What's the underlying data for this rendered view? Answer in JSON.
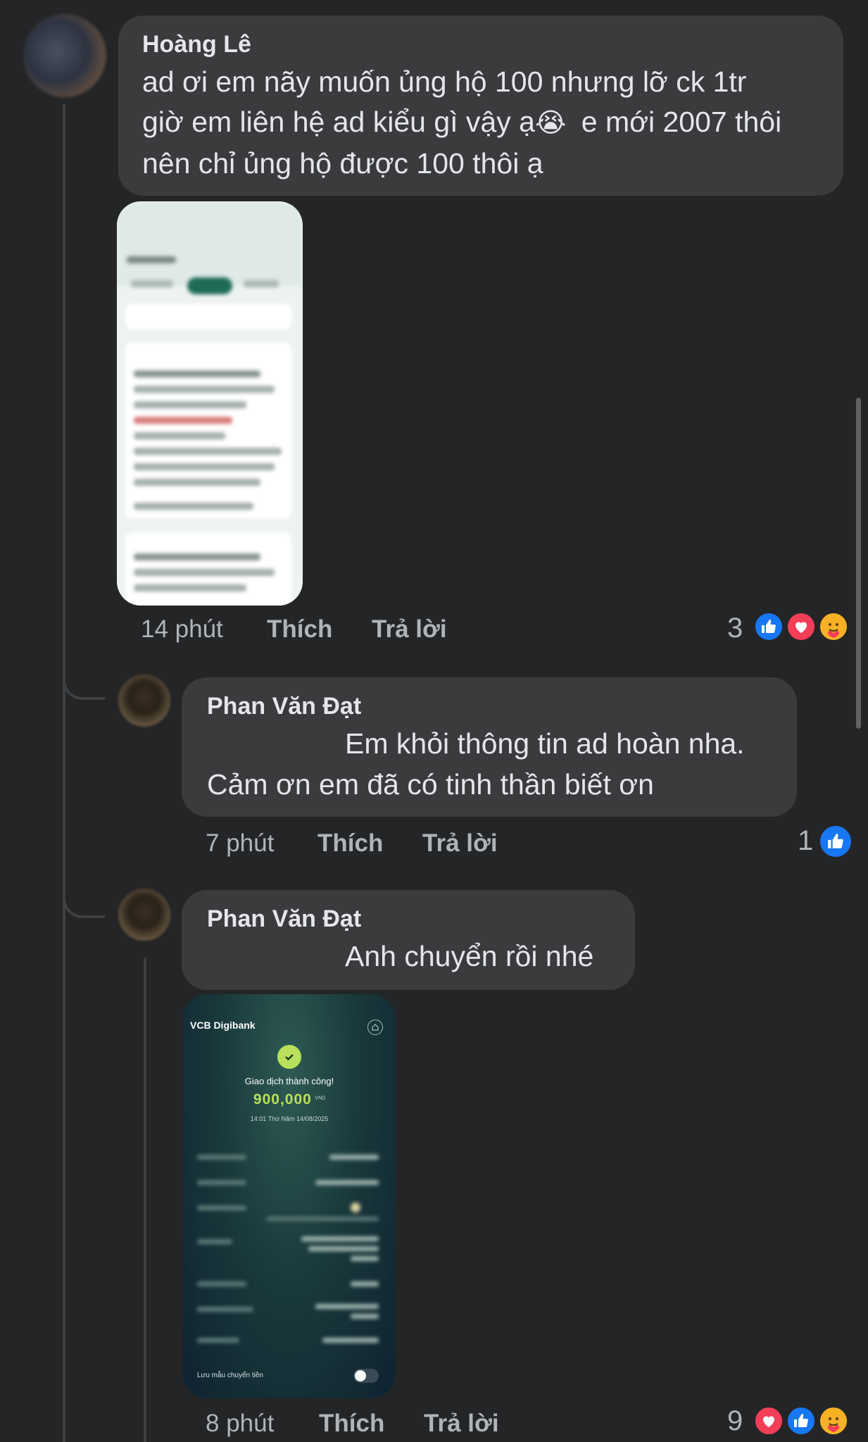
{
  "comments": [
    {
      "author": "Hoàng Lê",
      "lines": [
        "ad ơi em nãy muốn ủng hộ 100 nhưng lỡ ck 1tr",
        "giờ em liên hệ ad kiểu gì vậy ạ",
        "e mới 2007 thôi",
        "nên chỉ ủng hộ được 100 thôi ạ"
      ],
      "emoji": "😭",
      "time": "14 phút",
      "like": "Thích",
      "reply": "Trả lời",
      "reaction_count": "3"
    },
    {
      "author": "Phan Văn Đạt",
      "lines": [
        "Em khỏi thông tin ad hoàn nha.",
        "Cảm ơn em đã có tinh thần biết ơn"
      ],
      "time": "7 phút",
      "like": "Thích",
      "reply": "Trả lời",
      "reaction_count": "1"
    },
    {
      "author": "Phan Văn Đạt",
      "lines": [
        "Anh chuyển rồi nhé"
      ],
      "time": "8 phút",
      "like": "Thích",
      "reply": "Trả lời",
      "reaction_count": "9"
    }
  ],
  "receipt": {
    "bank": "VCB Digibank",
    "status": "Giao dịch thành công!",
    "amount": "900,000",
    "currency": "VND",
    "datetime": "14:01 Thứ Năm 14/08/2025",
    "save_template": "Lưu mẫu chuyển tiền"
  },
  "colors": {
    "background": "#242526",
    "bubble": "#3a3b3c",
    "like_blue": "#1877f2",
    "love_red": "#f33e58",
    "amount_green": "#b8e05a"
  }
}
